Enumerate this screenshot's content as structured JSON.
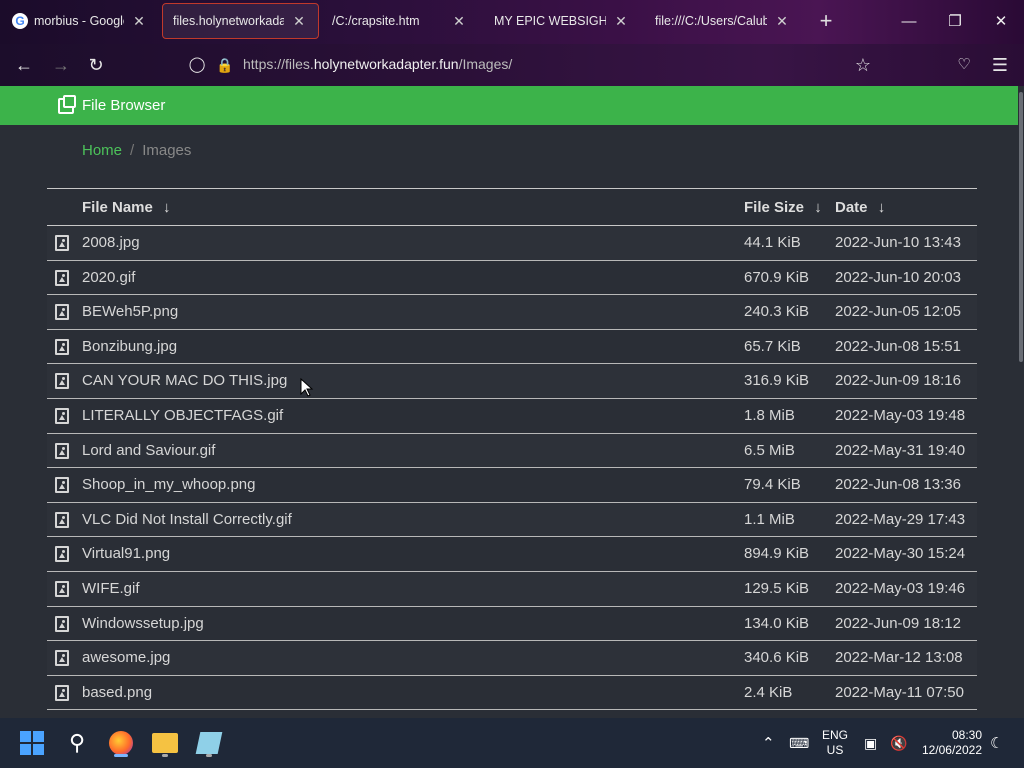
{
  "browser": {
    "tabs": [
      {
        "title": "morbius - Google S",
        "icon": "google-icon",
        "active": false
      },
      {
        "title": "files.holynetworkadapte",
        "icon": "",
        "active": true
      },
      {
        "title": "/C:/crapsite.htm",
        "icon": "",
        "active": false
      },
      {
        "title": "MY EPIC WEBSIGHT",
        "icon": "",
        "active": false
      },
      {
        "title": "file:///C:/Users/Calub%",
        "icon": "",
        "active": false
      }
    ],
    "new_tab_label": "+",
    "url_prefix": "https://files.",
    "url_domain": "holynetworkadapter.fun",
    "url_path": "/Images/"
  },
  "app": {
    "title": "File Browser",
    "accent_color": "#3cb34a",
    "breadcrumb": {
      "home": "Home",
      "separator": "/",
      "current": "Images"
    },
    "columns": {
      "name": "File Name",
      "size": "File Size",
      "date": "Date",
      "sort_arrow": "↓"
    },
    "files": [
      {
        "name": "2008.jpg",
        "size": "44.1 KiB",
        "date": "2022-Jun-10 13:43"
      },
      {
        "name": "2020.gif",
        "size": "670.9 KiB",
        "date": "2022-Jun-10 20:03"
      },
      {
        "name": "BEWeh5P.png",
        "size": "240.3 KiB",
        "date": "2022-Jun-05 12:05"
      },
      {
        "name": "Bonzibung.jpg",
        "size": "65.7 KiB",
        "date": "2022-Jun-08 15:51"
      },
      {
        "name": "CAN YOUR MAC DO THIS.jpg",
        "size": "316.9 KiB",
        "date": "2022-Jun-09 18:16"
      },
      {
        "name": "LITERALLY OBJECTFAGS.gif",
        "size": "1.8 MiB",
        "date": "2022-May-03 19:48"
      },
      {
        "name": "Lord and Saviour.gif",
        "size": "6.5 MiB",
        "date": "2022-May-31 19:40"
      },
      {
        "name": "Shoop_in_my_whoop.png",
        "size": "79.4 KiB",
        "date": "2022-Jun-08 13:36"
      },
      {
        "name": "VLC Did Not Install Correctly.gif",
        "size": "1.1 MiB",
        "date": "2022-May-29 17:43"
      },
      {
        "name": "Virtual91.png",
        "size": "894.9 KiB",
        "date": "2022-May-30 15:24"
      },
      {
        "name": "WIFE.gif",
        "size": "129.5 KiB",
        "date": "2022-May-03 19:46"
      },
      {
        "name": "Windowssetup.jpg",
        "size": "134.0 KiB",
        "date": "2022-Jun-09 18:12"
      },
      {
        "name": "awesome.jpg",
        "size": "340.6 KiB",
        "date": "2022-Mar-12 13:08"
      },
      {
        "name": "based.png",
        "size": "2.4 KiB",
        "date": "2022-May-11 07:50"
      }
    ]
  },
  "taskbar": {
    "lang_top": "ENG",
    "lang_bottom": "US",
    "time": "08:30",
    "date": "12/06/2022"
  }
}
